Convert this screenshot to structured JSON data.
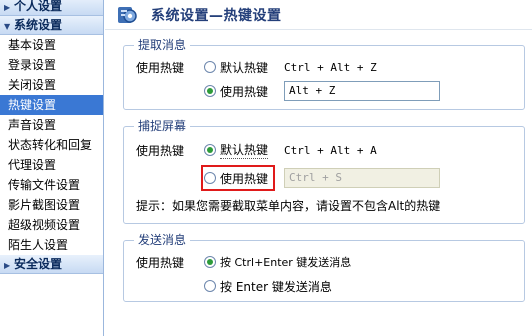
{
  "sidebar": {
    "categories": [
      {
        "label": "个人设置"
      },
      {
        "label": "系统设置"
      }
    ],
    "items": [
      {
        "label": "基本设置"
      },
      {
        "label": "登录设置"
      },
      {
        "label": "关闭设置"
      },
      {
        "label": "热键设置"
      },
      {
        "label": "声音设置"
      },
      {
        "label": "状态转化和回复"
      },
      {
        "label": "代理设置"
      },
      {
        "label": "传输文件设置"
      },
      {
        "label": "影片截图设置"
      },
      {
        "label": "超级视频设置"
      },
      {
        "label": "陌生人设置"
      }
    ],
    "bottom_category": {
      "label": "安全设置"
    },
    "selected_item": "热键设置"
  },
  "header": {
    "title": "系统设置—热键设置",
    "icon": "gear-icon"
  },
  "groups": {
    "extract": {
      "legend": "提取消息",
      "row_label": "使用热键",
      "default_option": "默认热键",
      "default_hotkey": "Ctrl + Alt + Z",
      "custom_option": "使用热键",
      "custom_value": "Alt + Z",
      "selected": "custom"
    },
    "capture": {
      "legend": "捕捉屏幕",
      "row_label": "使用热键",
      "default_option": "默认热键",
      "default_hotkey": "Ctrl + Alt + A",
      "custom_option": "使用热键",
      "custom_value": "Ctrl + S",
      "selected": "default",
      "hint": "提示：如果您需要截取菜单内容，请设置不包含Alt的热键"
    },
    "send": {
      "legend": "发送消息",
      "row_label": "使用热键",
      "option_ctrl_enter": "按 Ctrl+Enter 键发送消息",
      "option_enter": "按 Enter 键发送消息",
      "selected": "ctrl_enter"
    }
  },
  "colors": {
    "selected_bg": "#3a78d4",
    "highlight_box": "#e01a1a",
    "radio_dot": "#2d9b3a"
  }
}
